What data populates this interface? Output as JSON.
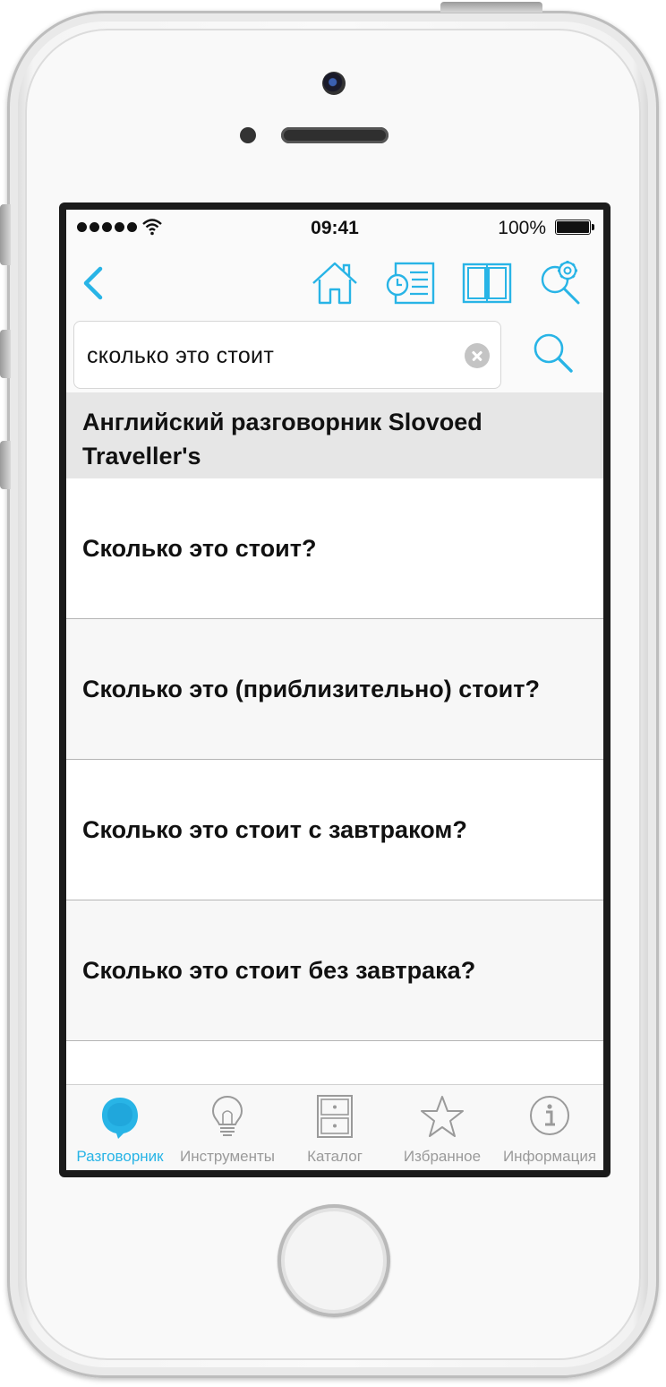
{
  "status_bar": {
    "time": "09:41",
    "battery": "100%"
  },
  "colors": {
    "accent": "#28b4e6",
    "icon_gray": "#9a9a9a",
    "header_bg": "#e6e6e6"
  },
  "navbar": {
    "icons": [
      "back-chevron-icon",
      "home-icon",
      "history-icon",
      "book-icon",
      "search-settings-icon"
    ]
  },
  "search": {
    "value": "сколько это стоит"
  },
  "section": {
    "title": "Английский разговорник Slovoed Traveller's"
  },
  "results": [
    "Сколько это стоит?",
    "Сколько это (приблизительно) стоит?",
    "Сколько это стоит с завтраком?",
    "Сколько это стоит без завтрака?",
    ""
  ],
  "tabbar": {
    "active": "Разговорник",
    "tabs": [
      {
        "label": "Разговорник",
        "icon": "speech-bubble-icon"
      },
      {
        "label": "Инструменты",
        "icon": "lightbulb-icon"
      },
      {
        "label": "Каталог",
        "icon": "catalog-drawer-icon"
      },
      {
        "label": "Избранное",
        "icon": "star-icon"
      },
      {
        "label": "Информация",
        "icon": "info-icon"
      }
    ]
  }
}
